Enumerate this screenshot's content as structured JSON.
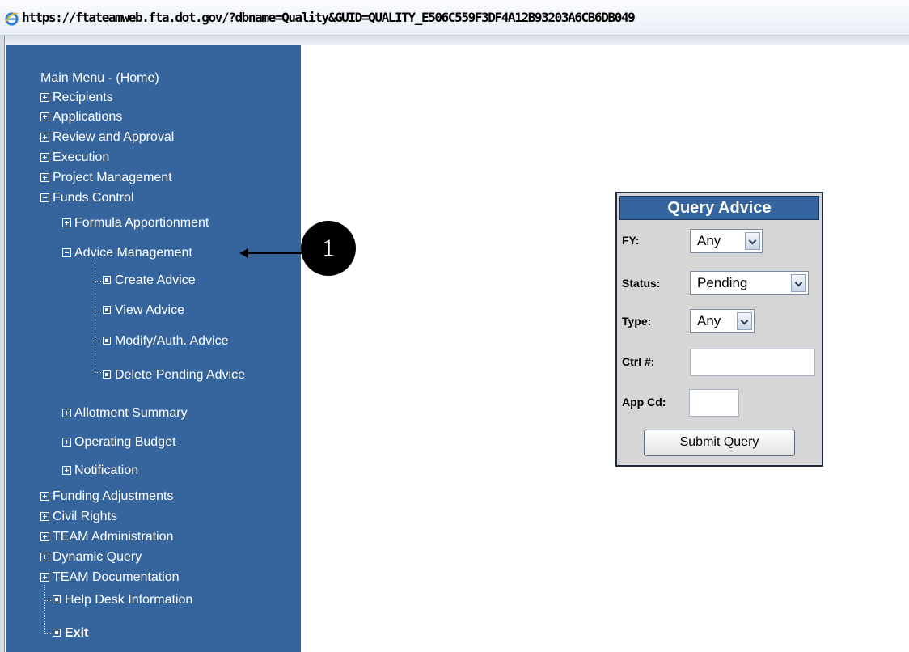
{
  "window": {
    "url": "https://ftateamweb.fta.dot.gov/?dbname=Quality&GUID=QUALITY_E506C559F3DF4A12B93203A6CB6DB049"
  },
  "sidebar": {
    "title": "Main Menu - (Home)",
    "items": {
      "recipients": "Recipients",
      "applications": "Applications",
      "review": "Review and Approval",
      "execution": "Execution",
      "project": "Project Management",
      "funds": "Funds Control",
      "formula": "Formula Apportionment",
      "advice_mgmt": "Advice Management",
      "create_advice": "Create Advice",
      "view_advice": "View Advice",
      "modify_advice": "Modify/Auth. Advice",
      "delete_advice": "Delete Pending Advice",
      "allotment": "Allotment Summary",
      "operating_budget": "Operating Budget",
      "notification": "Notification",
      "funding_adj": "Funding Adjustments",
      "civil_rights": "Civil Rights",
      "team_admin": "TEAM Administration",
      "dynamic_query": "Dynamic Query",
      "team_docs": "TEAM Documentation",
      "help_desk": "Help Desk Information",
      "exit": "Exit"
    }
  },
  "callout": {
    "number": "1"
  },
  "query_panel": {
    "title": "Query Advice",
    "fy_label": "FY:",
    "fy_value": "Any",
    "status_label": "Status:",
    "status_value": "Pending",
    "type_label": "Type:",
    "type_value": "Any",
    "ctrl_label": "Ctrl #:",
    "ctrl_value": "",
    "appcd_label": "App Cd:",
    "appcd_value": "",
    "submit_label": "Submit Query"
  },
  "colors": {
    "sidebar_bg": "#36659d",
    "panel_header_bg": "#34659e",
    "panel_bg": "#d6d6d6"
  }
}
